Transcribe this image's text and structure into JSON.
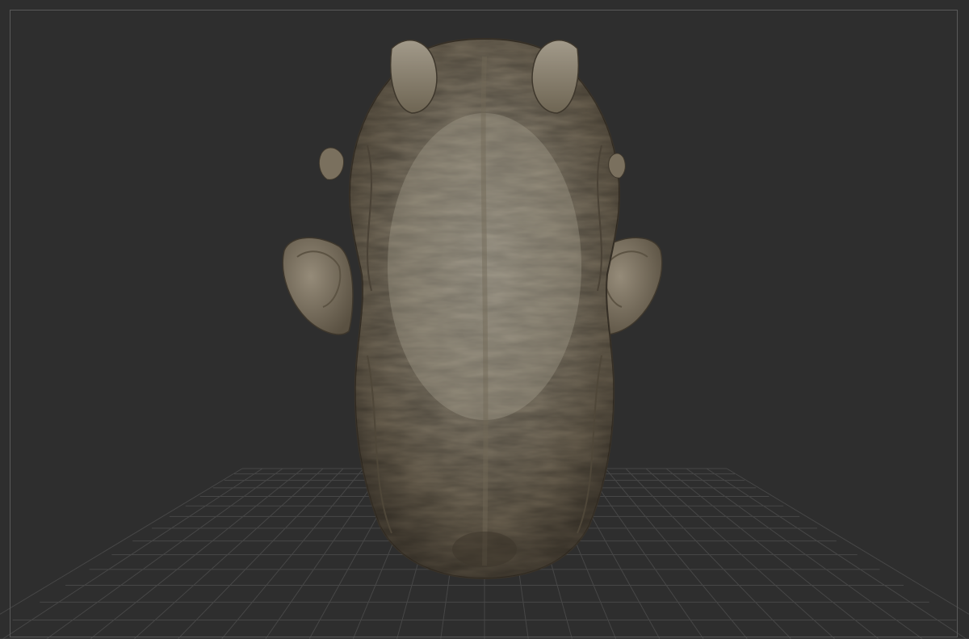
{
  "viewport": {
    "background_color": "#2e2e2e",
    "frame_color": "#5a5a5a",
    "grid_color": "#474747"
  },
  "model": {
    "subject": "sculpted-head",
    "view": "top",
    "material_color": "#8a8170"
  }
}
